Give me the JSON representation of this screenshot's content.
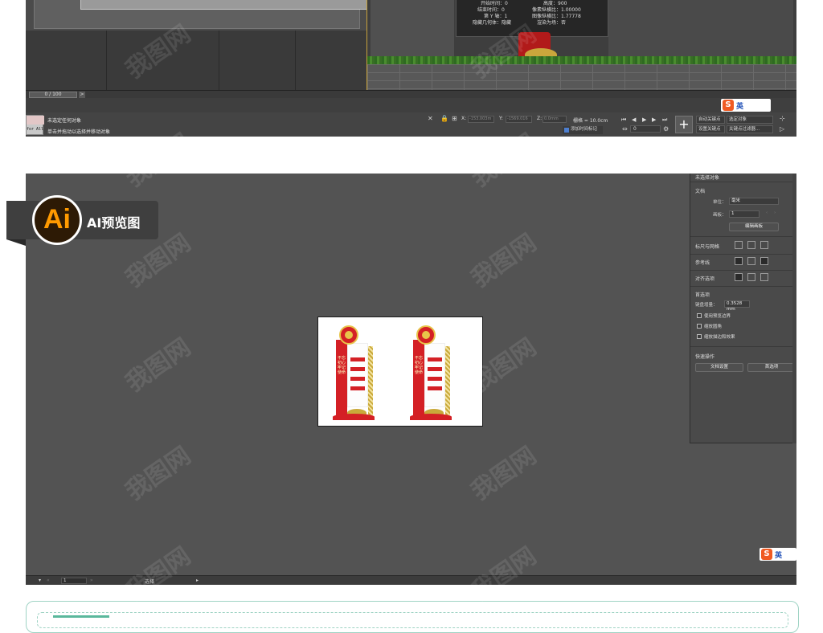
{
  "max_panel": {
    "stats": {
      "start_time_label": "开始时间：0",
      "end_time_label": "结束时间：0",
      "axis_label": "第 Y 轴：1",
      "hide_geo_label": "隐藏几何体：隐藏",
      "height_label": "高度：900",
      "pixel_ratio_label": "像素纵横比：1.00000",
      "image_ratio_label": "图像纵横比：1.77778",
      "render_label": "渲染为场：否"
    },
    "time_slider": "0 / 100",
    "time_next": ">",
    "maxscript_label": "for All",
    "status_line1": "未选定任何对象",
    "status_line2": "单击并拖动以选择并移动对象",
    "coord_x_label": "X:",
    "coord_x_value": "-153.003m",
    "coord_y_label": "Y:",
    "coord_y_value": "-1569.016",
    "coord_z_label": "Z:",
    "coord_z_value": "0.0mm",
    "grid_label": "栅格 = 10.0cm",
    "add_time_tag": "添加时间标记",
    "frame_value": "0",
    "auto_key": "自动关键点",
    "set_key": "设置关键点",
    "selected_object": "选定对象",
    "key_filter": "关键点过滤器...",
    "ime_label": "英"
  },
  "ai_badge": {
    "logo": "Ai",
    "label": "AI预览图"
  },
  "ai_panel": {
    "artboard_sign_text": "不忘初心 牢记使命",
    "props": {
      "no_selection": "未选择对象",
      "doc_section": "文档",
      "unit_label": "单位：",
      "unit_value": "毫米",
      "artboard_label": "画板：",
      "artboard_value": "1",
      "edit_artboard_btn": "编辑画板",
      "ruler_grid": "标尺与网格",
      "guides": "参考线",
      "snap_options": "对齐选项",
      "preferences": "首选项",
      "keyboard_increment_label": "键盘增量：",
      "keyboard_increment_value": "0.3528 mm",
      "use_preview_bounds": "使用预览边界",
      "scale_corners": "缩放圆角",
      "scale_strokes": "缩放描边和效果",
      "quick_actions": "快速操作",
      "doc_setup_btn": "文档设置",
      "prefs_btn": "首选项"
    },
    "statusbar": {
      "zoom": "1",
      "tool": "选择",
      "nav_prev": "«",
      "nav_next": "»"
    },
    "ime_label": "英"
  },
  "watermark": "我图网",
  "colors": {
    "max_bg": "#444444",
    "ai_bg": "#535353",
    "sign_red": "#d42025",
    "sign_gold": "#c9a93a",
    "ai_orange": "#ff9a00",
    "accent_teal": "#9fd3c4"
  },
  "icons": [
    "lock-icon",
    "select-icon",
    "key-icon",
    "play-icon",
    "plus-icon",
    "align-icon",
    "grid-icon"
  ]
}
